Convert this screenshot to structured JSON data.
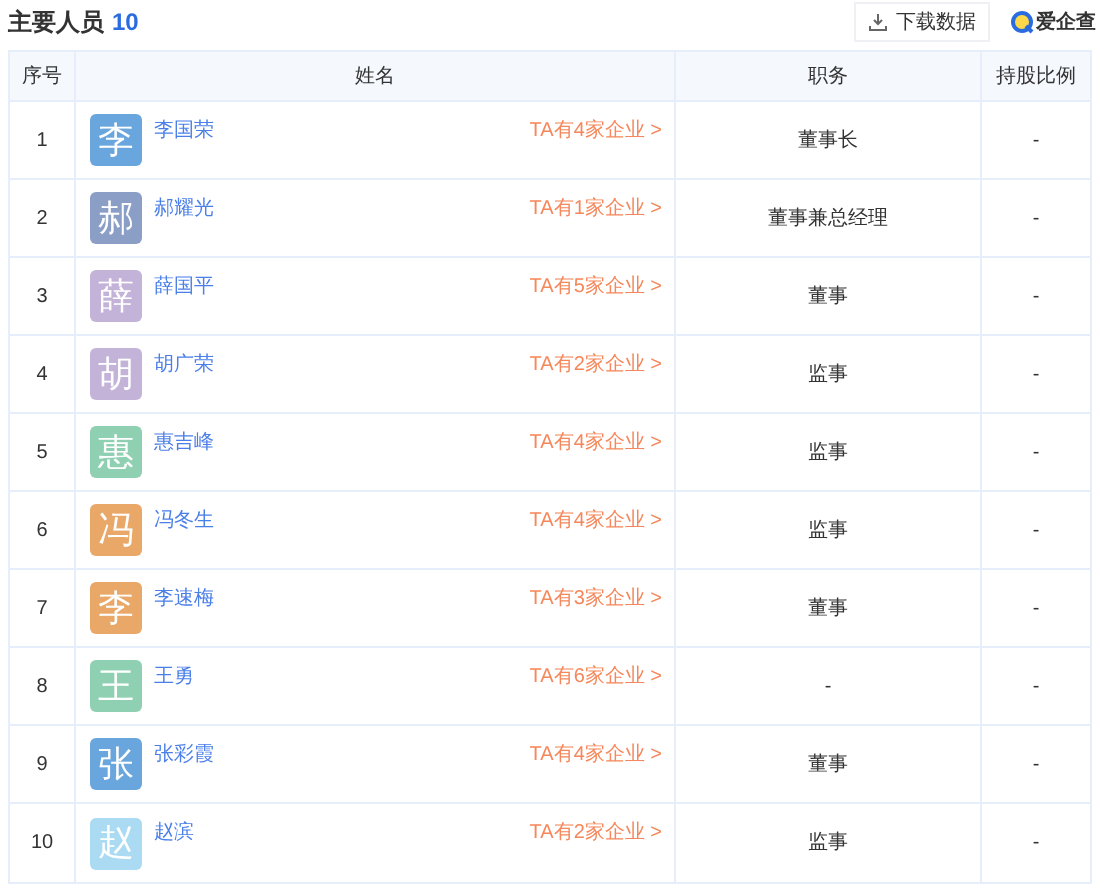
{
  "header": {
    "title": "主要人员",
    "count": "10",
    "download_button": "下载数据",
    "logo_text": "爱企查"
  },
  "table": {
    "columns": [
      "序号",
      "姓名",
      "职务",
      "持股比例"
    ],
    "rows": [
      {
        "index": "1",
        "avatar": "李",
        "color": "#6aa6de",
        "name": "李国荣",
        "companies": "TA有4家企业 >",
        "position": "董事长",
        "share": "-"
      },
      {
        "index": "2",
        "avatar": "郝",
        "color": "#8b9fc6",
        "name": "郝耀光",
        "companies": "TA有1家企业 >",
        "position": "董事兼总经理",
        "share": "-"
      },
      {
        "index": "3",
        "avatar": "薛",
        "color": "#c4b3d8",
        "name": "薛国平",
        "companies": "TA有5家企业 >",
        "position": "董事",
        "share": "-"
      },
      {
        "index": "4",
        "avatar": "胡",
        "color": "#c4b3d8",
        "name": "胡广荣",
        "companies": "TA有2家企业 >",
        "position": "监事",
        "share": "-"
      },
      {
        "index": "5",
        "avatar": "惠",
        "color": "#8fd0b2",
        "name": "惠吉峰",
        "companies": "TA有4家企业 >",
        "position": "监事",
        "share": "-"
      },
      {
        "index": "6",
        "avatar": "冯",
        "color": "#e9a867",
        "name": "冯冬生",
        "companies": "TA有4家企业 >",
        "position": "监事",
        "share": "-"
      },
      {
        "index": "7",
        "avatar": "李",
        "color": "#e9a867",
        "name": "李速梅",
        "companies": "TA有3家企业 >",
        "position": "董事",
        "share": "-"
      },
      {
        "index": "8",
        "avatar": "王",
        "color": "#8fd0b2",
        "name": "王勇",
        "companies": "TA有6家企业 >",
        "position": "-",
        "share": "-"
      },
      {
        "index": "9",
        "avatar": "张",
        "color": "#6aa6de",
        "name": "张彩霞",
        "companies": "TA有4家企业 >",
        "position": "董事",
        "share": "-"
      },
      {
        "index": "10",
        "avatar": "赵",
        "color": "#aadbf2",
        "name": "赵滨",
        "companies": "TA有2家企业 >",
        "position": "监事",
        "share": "-"
      }
    ]
  }
}
